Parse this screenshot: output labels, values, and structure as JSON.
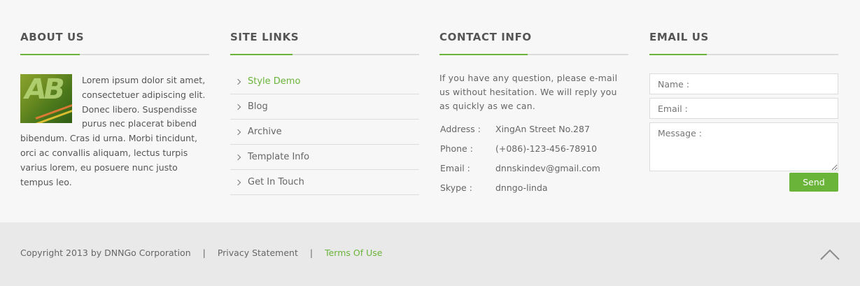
{
  "about": {
    "title": "ABOUT US",
    "image_icon": "ab-letters-thumbnail",
    "text": "Lorem ipsum dolor sit amet, consectetuer adipiscing elit. Donec libero. Suspendisse purus nec placerat bibend bibendum. Cras id urna. Morbi tincidunt, orci ac convallis aliquam, lectus turpis varius lorem, eu posuere nunc justo tempus leo."
  },
  "links": {
    "title": "SITE LINKS",
    "items": [
      {
        "label": "Style Demo"
      },
      {
        "label": "Blog"
      },
      {
        "label": "Archive"
      },
      {
        "label": "Template Info"
      },
      {
        "label": "Get In Touch"
      }
    ]
  },
  "contact": {
    "title": "CONTACT INFO",
    "intro": "If you have any question, please e-mail us without hesitation. We will reply you as quickly as we can.",
    "rows": [
      {
        "label": "Address :",
        "value": "XingAn Street No.287"
      },
      {
        "label": "Phone :",
        "value": "(+086)-123-456-78910"
      },
      {
        "label": "Email :",
        "value": "dnnskindev@gmail.com"
      },
      {
        "label": "Skype :",
        "value": "dnngo-linda"
      }
    ]
  },
  "email": {
    "title": "EMAIL US",
    "name_placeholder": "Name :",
    "email_placeholder": "Email :",
    "message_placeholder": "Message :",
    "send_label": "Send"
  },
  "footer": {
    "copyright": "Copyright 2013 by DNNGo Corporation",
    "separator": "|",
    "privacy": "Privacy Statement",
    "terms": "Terms Of Use",
    "to_top_icon": "chevron-up-icon"
  },
  "colors": {
    "accent": "#6ab43a",
    "heading": "#555555",
    "text": "#666666",
    "bottom_bar": "#e9e9e9",
    "background": "#f7f7f7"
  }
}
